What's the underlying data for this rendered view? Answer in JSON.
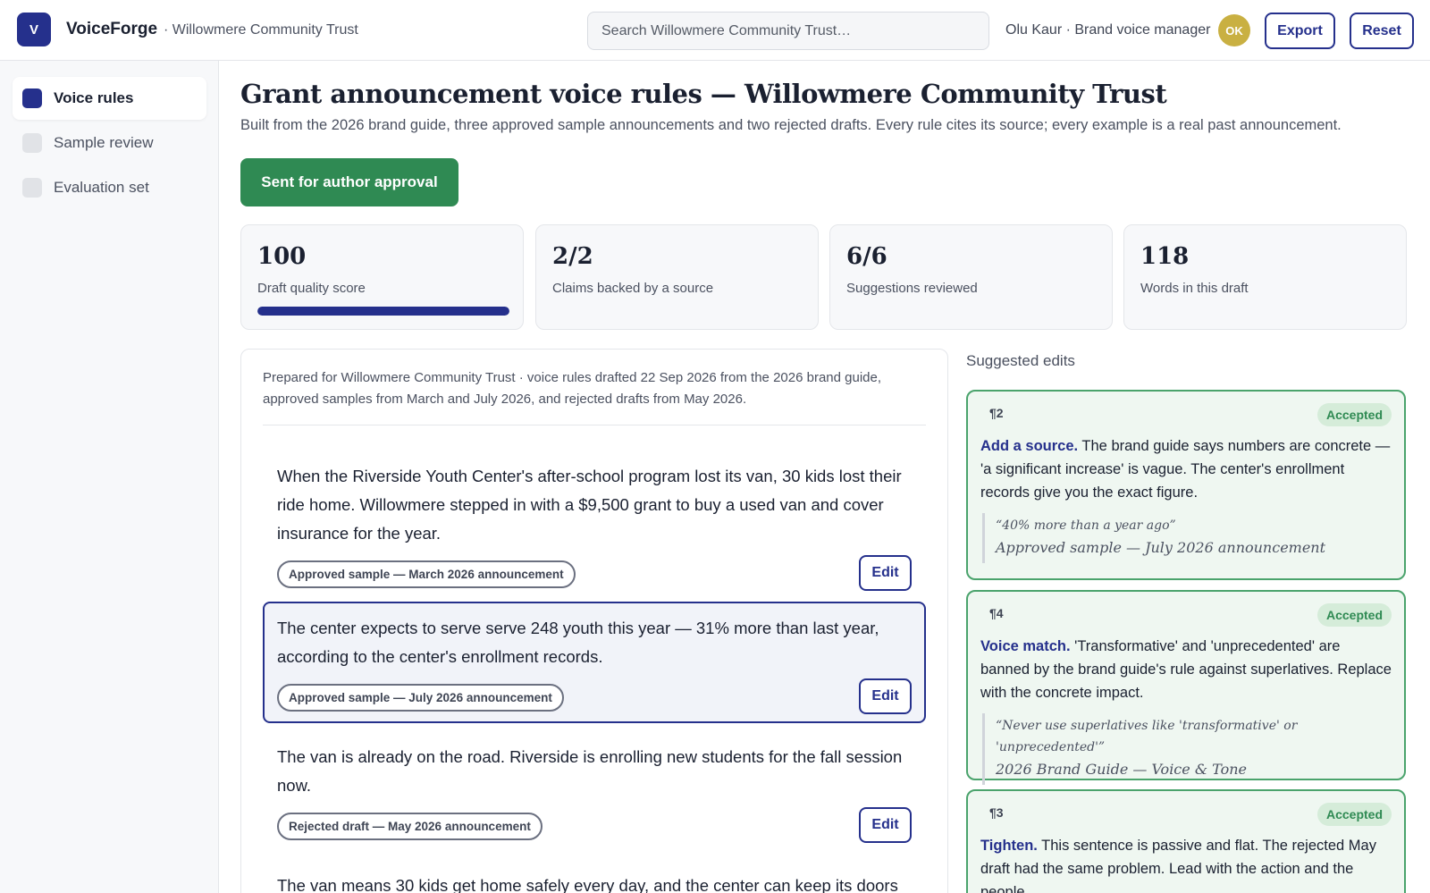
{
  "app": {
    "logo_letter": "V",
    "name": "VoiceForge",
    "org": "· Willowmere Community Trust",
    "search_placeholder": "Search Willowmere Community Trust…",
    "user": "Olu Kaur · Brand voice manager",
    "avatar_initials": "OK",
    "export_label": "Export",
    "reset_label": "Reset"
  },
  "sidebar": {
    "items": [
      {
        "label": "Voice rules",
        "active": true
      },
      {
        "label": "Sample review",
        "active": false
      },
      {
        "label": "Evaluation set",
        "active": false
      }
    ]
  },
  "page": {
    "title": "Grant announcement voice rules — Willowmere Community Trust",
    "subtitle": "Built from the 2026 brand guide, three approved sample announcements and two rejected drafts. Every rule cites its source; every example is a real past announcement.",
    "status_label": "Sent for author approval"
  },
  "stats": [
    {
      "value": "100",
      "label": "Draft quality score",
      "progress": 1.0
    },
    {
      "value": "2/2",
      "label": "Claims backed by a source"
    },
    {
      "value": "6/6",
      "label": "Suggestions reviewed"
    },
    {
      "value": "118",
      "label": "Words in this draft"
    }
  ],
  "draft": {
    "meta": "Prepared for Willowmere Community Trust · voice rules drafted 22 Sep 2026 from the 2026 brand guide, approved samples from March and July 2026, and rejected drafts from May 2026.",
    "edit_label": "Edit",
    "paragraphs": [
      {
        "text": "When the Riverside Youth Center's after-school program lost its van, 30 kids lost their ride home. Willowmere stepped in with a $9,500 grant to buy a used van and cover insurance for the year.",
        "tag": "Approved sample — March 2026 announcement"
      },
      {
        "text": "The center expects to serve serve 248 youth this year — 31% more than last year, according to the center's enrollment records.",
        "tag": "Approved sample — July 2026 announcement",
        "selected": true
      },
      {
        "text": "The van is already on the road. Riverside is enrolling new students for the fall session now.",
        "tag": "Rejected draft — May 2026 announcement"
      },
      {
        "text": "The van means 30 kids get home safely every day, and the center can keep its doors"
      }
    ]
  },
  "suggestions": {
    "title": "Suggested edits",
    "items": [
      {
        "para": "¶2",
        "status": "Accepted",
        "kind": "Add a source.",
        "body": "The brand guide says numbers are concrete — 'a significant increase' is vague. The center's enrollment records give you the exact figure.",
        "quote": "“40% more than a year ago”",
        "source": "Approved sample — July 2026 announcement"
      },
      {
        "para": "¶4",
        "status": "Accepted",
        "kind": "Voice match.",
        "body": "'Transformative' and 'unprecedented' are banned by the brand guide's rule against superlatives. Replace with the concrete impact.",
        "quote": "“Never use superlatives like 'transformative' or 'unprecedented'”",
        "source": "2026 Brand Guide — Voice & Tone"
      },
      {
        "para": "¶3",
        "status": "Accepted",
        "kind": "Tighten.",
        "body": "This sentence is passive and flat. The rejected May draft had the same problem. Lead with the action and the people."
      }
    ]
  }
}
